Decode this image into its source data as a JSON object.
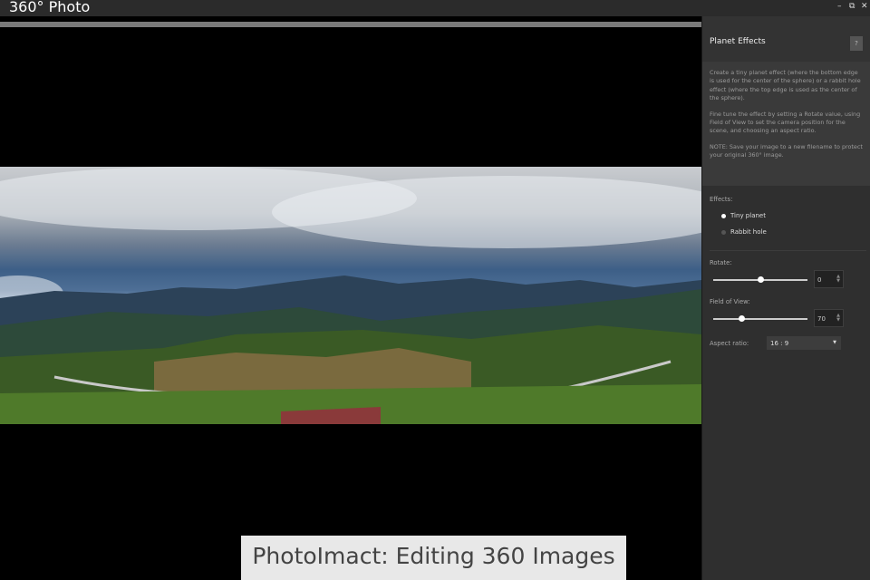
{
  "window": {
    "title": "360° Photo",
    "minimize": "–",
    "restore": "⧉",
    "close": "✕"
  },
  "panel": {
    "title": "Planet Effects",
    "help": "?",
    "description": [
      "Create a tiny planet effect (where the bottom edge is used for the center of the sphere) or a rabbit hole effect (where the top edge is used as the center of the sphere).",
      "Fine tune the effect by setting a Rotate value, using Field of View to set the camera position for the scene, and choosing an aspect ratio.",
      "NOTE: Save your image to a new filename to protect your original 360° image."
    ],
    "effects_label": "Effects:",
    "effects": [
      {
        "label": "Tiny planet",
        "selected": true
      },
      {
        "label": "Rabbit hole",
        "selected": false
      }
    ],
    "rotate": {
      "label": "Rotate:",
      "value": "0",
      "slider_fraction": 0.5
    },
    "fov": {
      "label": "Field of View:",
      "value": "70",
      "slider_fraction": 0.3
    },
    "aspect": {
      "label": "Aspect ratio:",
      "value": "16 : 9"
    }
  },
  "caption": "PhotoImact: Editing 360 Images"
}
